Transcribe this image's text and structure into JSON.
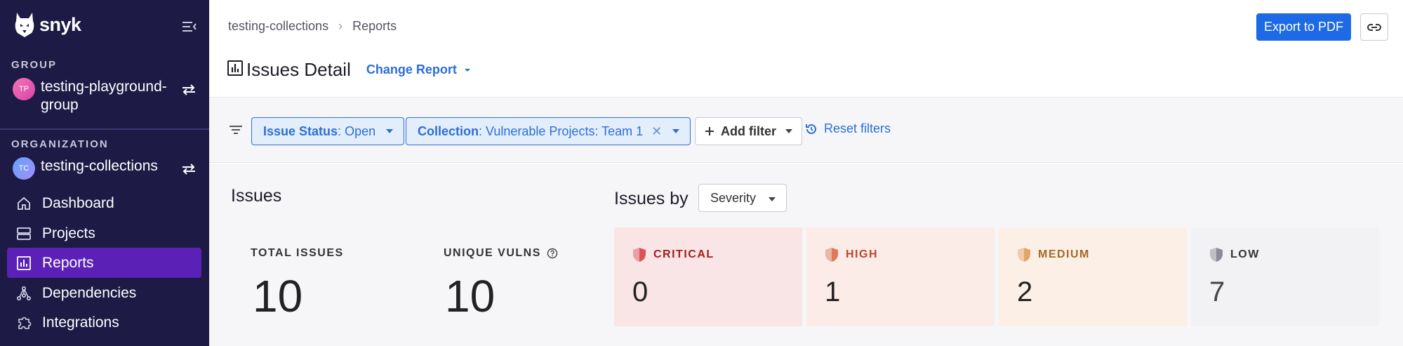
{
  "sidebar": {
    "brand": "snyk",
    "group_label": "GROUP",
    "group": {
      "initials": "TP",
      "name_line1": "testing-playground-",
      "name_line2": "group"
    },
    "org_label": "ORGANIZATION",
    "org": {
      "initials": "TC",
      "name": "testing-collections"
    },
    "nav": [
      {
        "label": "Dashboard",
        "icon": "home-icon",
        "active": false
      },
      {
        "label": "Projects",
        "icon": "projects-icon",
        "active": false
      },
      {
        "label": "Reports",
        "icon": "reports-icon",
        "active": true
      },
      {
        "label": "Dependencies",
        "icon": "dependencies-icon",
        "active": false
      },
      {
        "label": "Integrations",
        "icon": "integrations-icon",
        "active": false
      }
    ]
  },
  "header": {
    "breadcrumb": [
      "testing-collections",
      "Reports"
    ],
    "title": "Issues Detail",
    "change_report": "Change Report",
    "export_label": "Export to PDF"
  },
  "filters": {
    "chips": [
      {
        "key": "Issue Status",
        "value": "Open",
        "clearable": false
      },
      {
        "key": "Collection",
        "value": "Vulnerable Projects: Team 1",
        "clearable": true
      }
    ],
    "add_filter": "Add filter",
    "reset": "Reset filters"
  },
  "issues": {
    "heading": "Issues",
    "total_label": "TOTAL ISSUES",
    "total_value": "10",
    "unique_label": "UNIQUE VULNS",
    "unique_value": "10"
  },
  "issues_by": {
    "label": "Issues by",
    "selected": "Severity",
    "cards": [
      {
        "label": "CRITICAL",
        "value": "0",
        "bg": "#f9e5e5",
        "color": "#a3201f",
        "icon_color": "#d9545a"
      },
      {
        "label": "HIGH",
        "value": "1",
        "bg": "#fbece8",
        "color": "#b5482f",
        "icon_color": "#e0795c"
      },
      {
        "label": "MEDIUM",
        "value": "2",
        "bg": "#fcf0e6",
        "color": "#a5682a",
        "icon_color": "#e2a568"
      },
      {
        "label": "LOW",
        "value": "7",
        "bg": "#f2f2f4",
        "color": "#333333",
        "icon_color": "#8a8d98"
      }
    ]
  },
  "colors": {
    "sidebar_bg": "#1d1a45",
    "nav_active": "#5b21b6",
    "accent": "#1e6ae6"
  }
}
